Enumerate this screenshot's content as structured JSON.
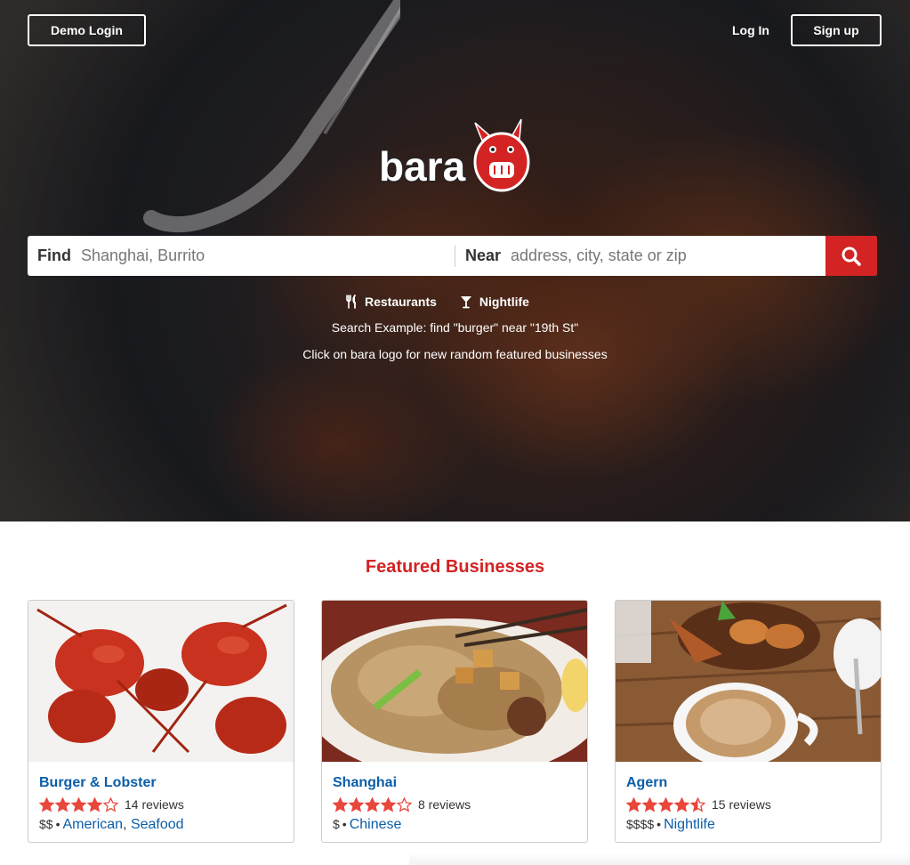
{
  "nav": {
    "demo_login": "Demo Login",
    "log_in": "Log In",
    "sign_up": "Sign up"
  },
  "logo_text": "bara",
  "search": {
    "find_label": "Find",
    "find_placeholder": "Shanghai, Burrito",
    "near_label": "Near",
    "near_placeholder": "address, city, state or zip",
    "button_icon": "search-icon"
  },
  "categories": [
    {
      "label": "Restaurants",
      "icon": "fork-knife-icon"
    },
    {
      "label": "Nightlife",
      "icon": "cocktail-icon"
    }
  ],
  "hints": {
    "example": "Search Example: find \"burger\" near \"19th St\"",
    "logo_tip": "Click on bara logo for new random featured businesses"
  },
  "featured": {
    "title": "Featured Businesses",
    "items": [
      {
        "name": "Burger & Lobster",
        "rating": 4,
        "reviews": "14 reviews",
        "price": "$$",
        "categories": [
          "American",
          "Seafood"
        ],
        "image": "lobster-photo"
      },
      {
        "name": "Shanghai",
        "rating": 4,
        "reviews": "8 reviews",
        "price": "$",
        "categories": [
          "Chinese"
        ],
        "image": "noodles-photo"
      },
      {
        "name": "Agern",
        "rating": 4.5,
        "reviews": "15 reviews",
        "price": "$$$$",
        "categories": [
          "Nightlife"
        ],
        "image": "coffee-photo"
      }
    ]
  },
  "colors": {
    "brand_red": "#d32323",
    "link_blue": "#0b5ea8",
    "star_red": "#e8473c"
  }
}
